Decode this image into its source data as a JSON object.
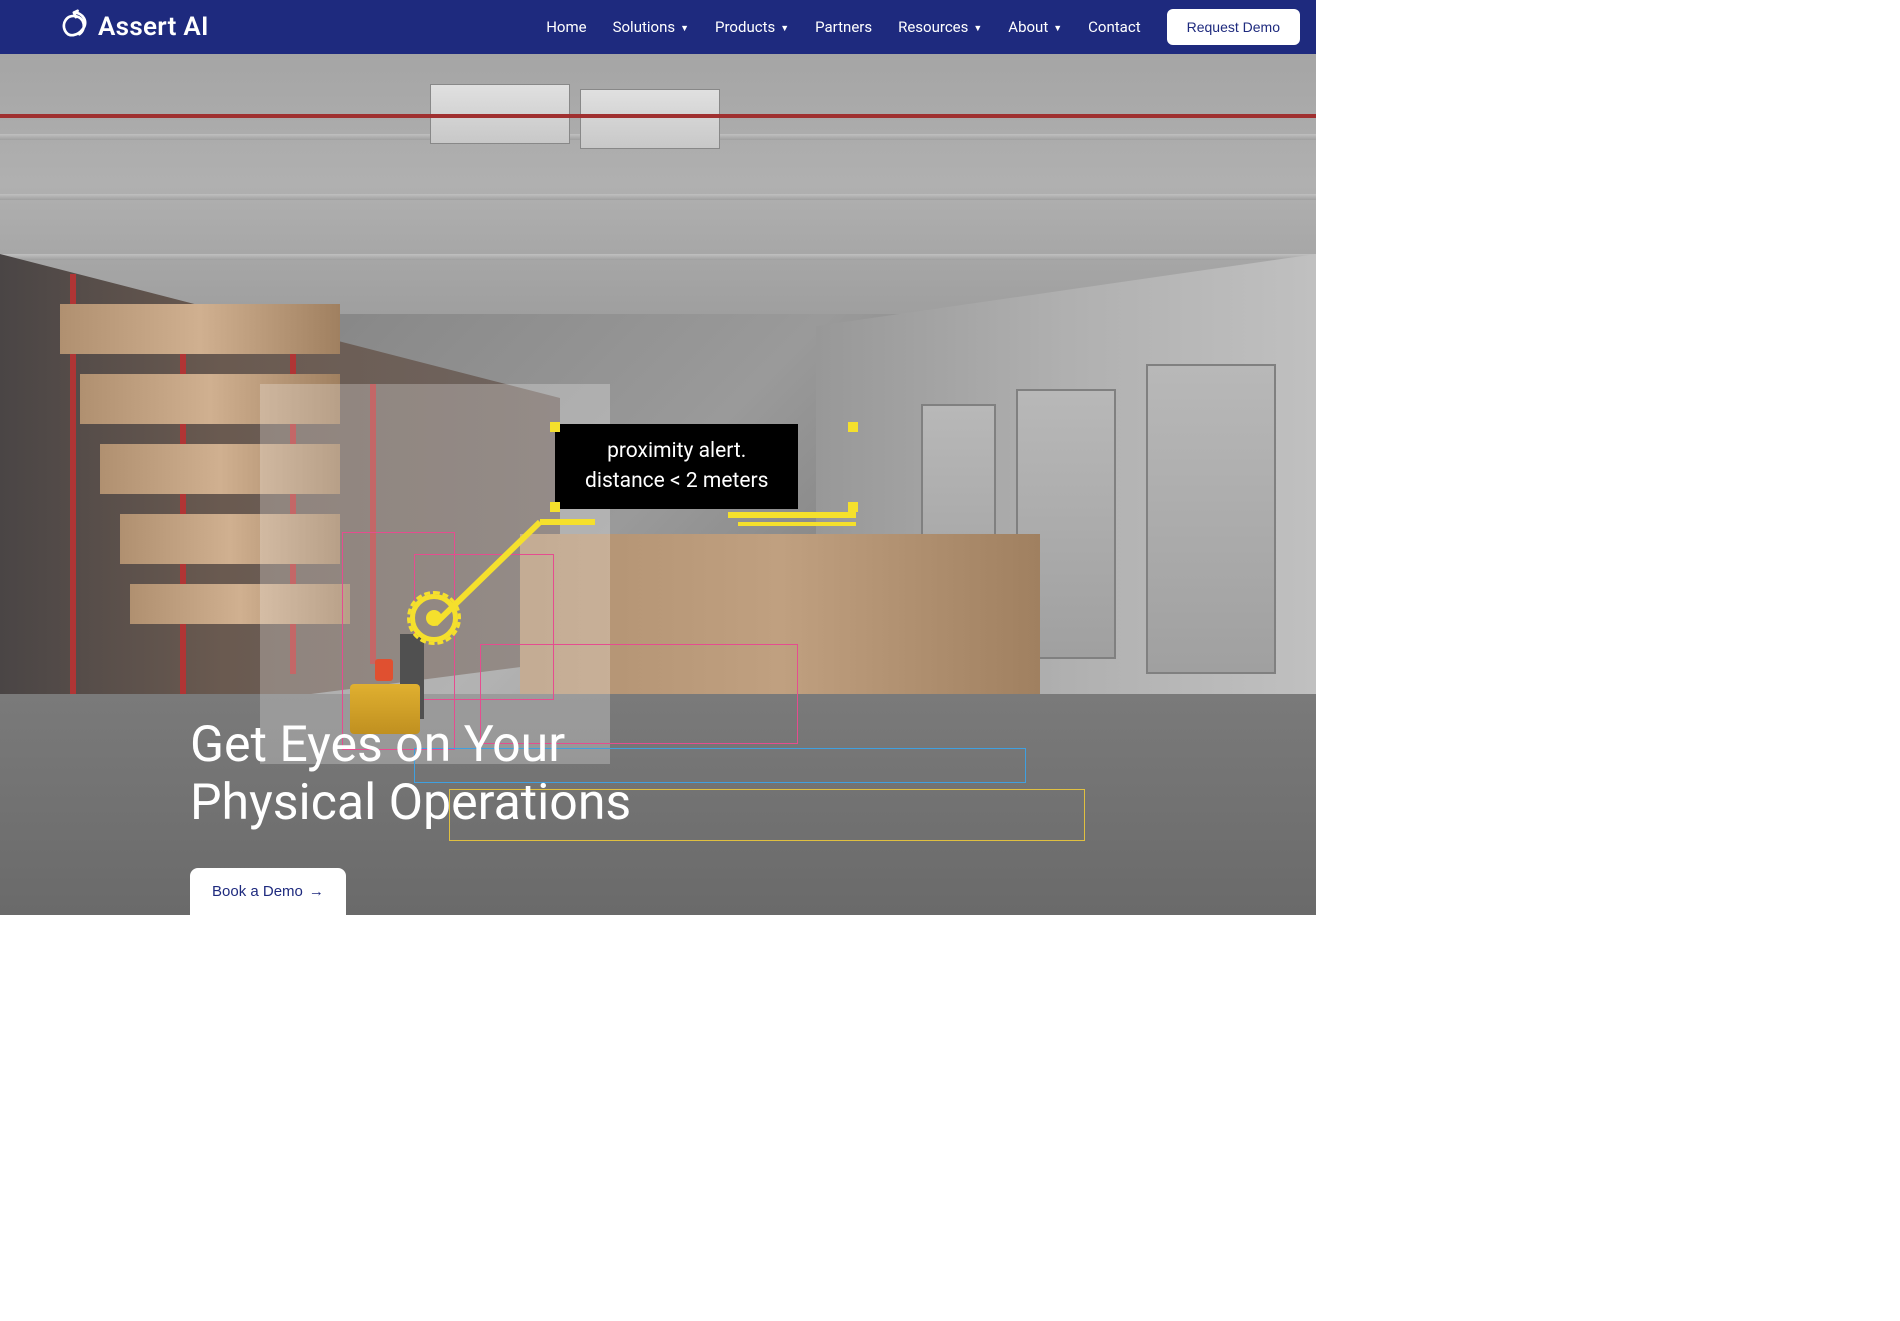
{
  "brand": {
    "name": "Assert AI"
  },
  "nav": {
    "items": [
      {
        "label": "Home",
        "hasDropdown": false
      },
      {
        "label": "Solutions",
        "hasDropdown": true
      },
      {
        "label": "Products",
        "hasDropdown": true
      },
      {
        "label": "Partners",
        "hasDropdown": false
      },
      {
        "label": "Resources",
        "hasDropdown": true
      },
      {
        "label": "About",
        "hasDropdown": true
      },
      {
        "label": "Contact",
        "hasDropdown": false
      }
    ],
    "cta": "Request Demo"
  },
  "hero": {
    "title_line1": "Get Eyes on Your",
    "title_line2": "Physical Operations",
    "cta": "Book a Demo"
  },
  "annotation": {
    "line1": "proximity alert.",
    "line2": "distance < 2 meters"
  },
  "colors": {
    "navy": "#1e2a7e",
    "white": "#ffffff",
    "yellow": "#f5e02c",
    "pink": "#e54d8f",
    "blue": "#3fa0e0"
  }
}
